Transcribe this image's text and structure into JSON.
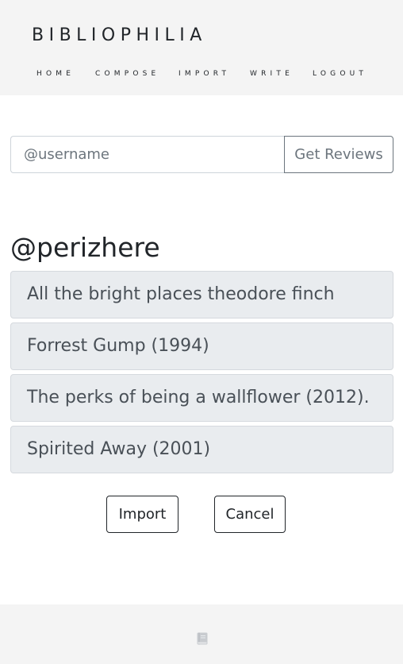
{
  "header": {
    "brand": "BIBLIOPHILIA",
    "nav": [
      {
        "label": "HOME"
      },
      {
        "label": "COMPOSE"
      },
      {
        "label": "IMPORT"
      },
      {
        "label": "WRITE"
      },
      {
        "label": "LOGOUT"
      }
    ]
  },
  "search": {
    "value": "",
    "placeholder": "@username",
    "button_label": "Get Reviews"
  },
  "results": {
    "username": "@perizhere",
    "items": [
      {
        "title": "All the bright places theodore finch"
      },
      {
        "title": "Forrest Gump (1994)"
      },
      {
        "title": "The perks of being a wallflower (2012)."
      },
      {
        "title": "Spirited Away (2001)"
      }
    ]
  },
  "actions": {
    "import_label": "Import",
    "cancel_label": "Cancel"
  },
  "footer": {
    "icon": "book-icon",
    "icon_color": "#c8cbcf"
  }
}
